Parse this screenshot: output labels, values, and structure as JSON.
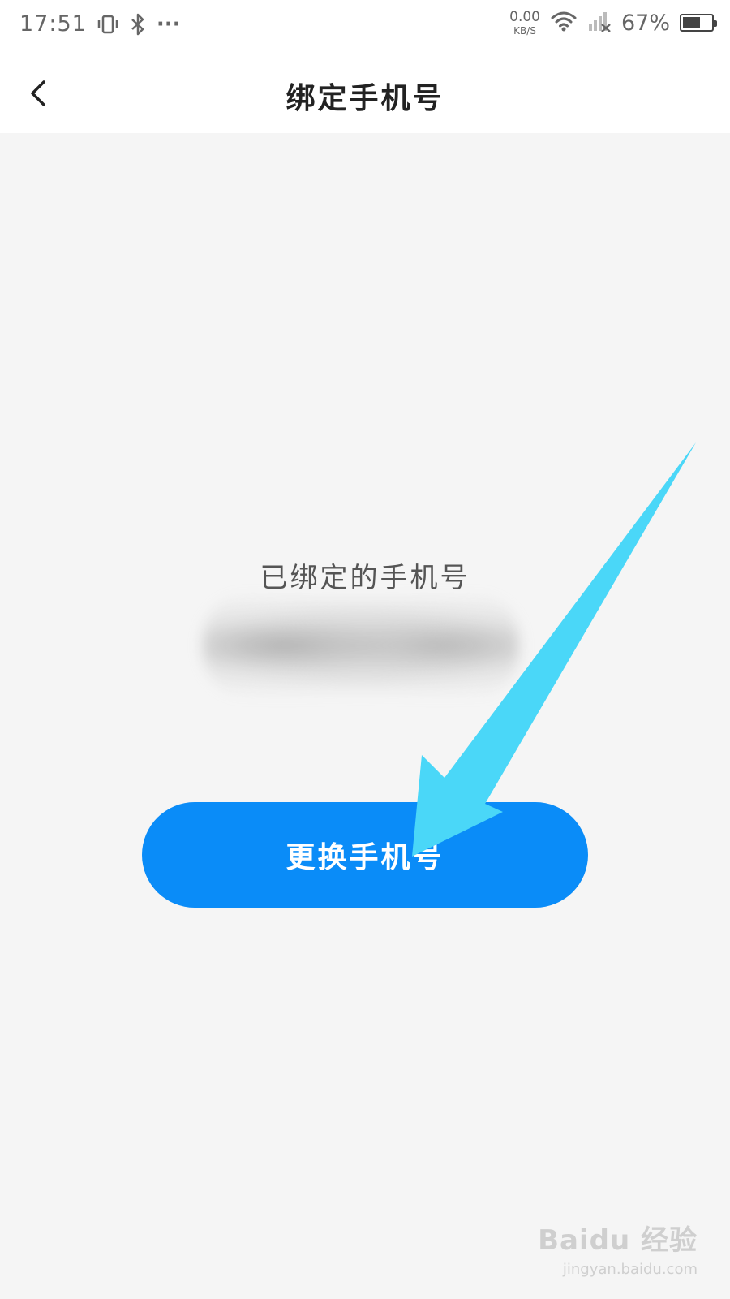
{
  "status_bar": {
    "time": "17:51",
    "more": "···",
    "net_speed_value": "0.00",
    "net_speed_unit": "KB/S",
    "battery_percent": "67%",
    "battery_level": 0.67,
    "icons": [
      "vibrate-icon",
      "bluetooth-icon",
      "wifi-icon",
      "signal-off-icon",
      "battery-icon"
    ]
  },
  "nav": {
    "title": "绑定手机号",
    "back_icon": "chevron-left-icon"
  },
  "main": {
    "bound_label": "已绑定的手机号",
    "change_button_label": "更换手机号"
  },
  "colors": {
    "primary_button": "#0a8cf8",
    "annotation_arrow": "#4ad7f8",
    "background": "#f5f5f5"
  },
  "watermark": {
    "logo": "Baidu 经验",
    "url": "jingyan.baidu.com"
  }
}
